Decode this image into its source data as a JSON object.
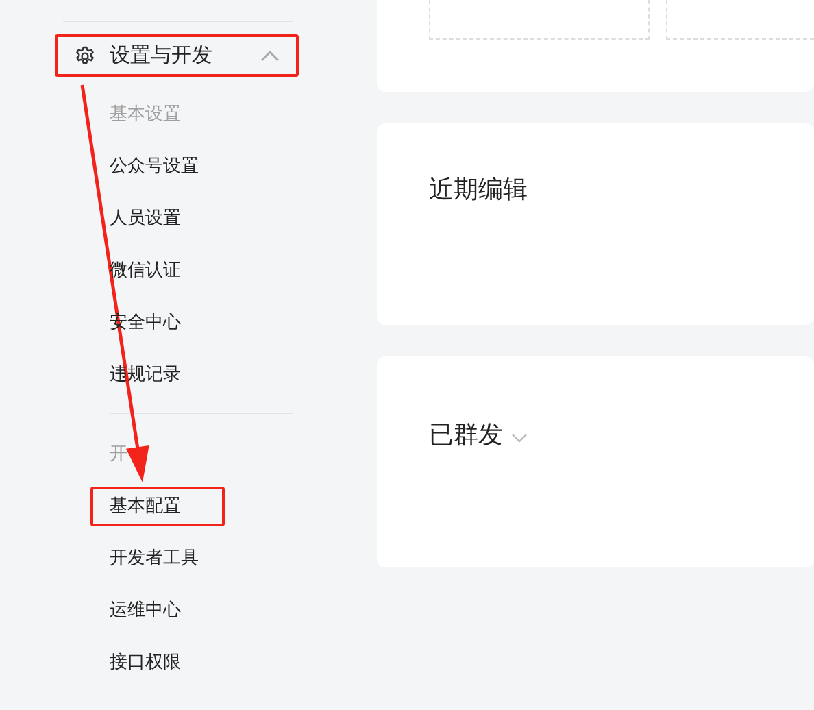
{
  "sidebar": {
    "group": {
      "label": "设置与开发",
      "expanded": true,
      "highlighted": true
    },
    "sections": [
      {
        "heading": "基本设置",
        "items": [
          {
            "label": "公众号设置",
            "highlighted": false
          },
          {
            "label": "人员设置",
            "highlighted": false
          },
          {
            "label": "微信认证",
            "highlighted": false
          },
          {
            "label": "安全中心",
            "highlighted": false
          },
          {
            "label": "违规记录",
            "highlighted": false
          }
        ]
      },
      {
        "heading": "开",
        "items": [
          {
            "label": "基本配置",
            "highlighted": true
          },
          {
            "label": "开发者工具",
            "highlighted": false
          },
          {
            "label": "运维中心",
            "highlighted": false
          },
          {
            "label": "接口权限",
            "highlighted": false
          }
        ]
      }
    ]
  },
  "cards": [
    {
      "title": "近期编辑",
      "dropdown": false
    },
    {
      "title": "已群发",
      "dropdown": true
    }
  ]
}
